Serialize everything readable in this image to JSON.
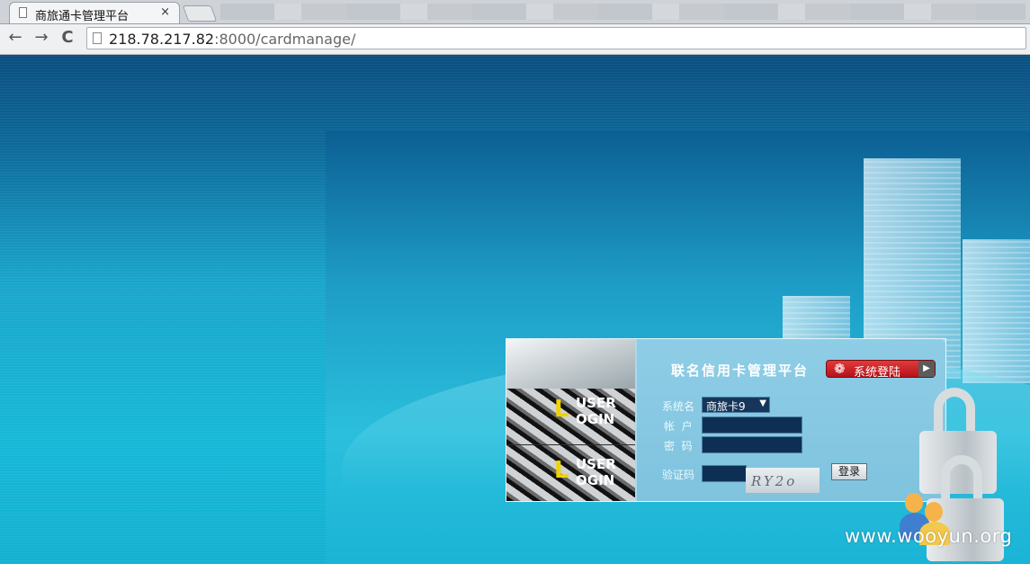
{
  "browser": {
    "tab_title": "商旅通卡管理平台",
    "tab_close": "×",
    "url_host": "218.78.217.82",
    "url_rest": ":8000/cardmanage/",
    "nav_back": "←",
    "nav_forward": "→",
    "nav_reload": "C"
  },
  "login": {
    "badge_letter": "L",
    "badge_line1": "USER",
    "badge_line2": "OGIN",
    "title": "联名信用卡管理平台",
    "system_login_button": "系统登陆",
    "system_label": "系统名",
    "system_value": "商旅卡9",
    "account_label": "帐  户",
    "password_label": "密  码",
    "captcha_label": "验证码",
    "captcha_text": "RY2o",
    "login_button": "登录"
  },
  "watermark": "www.wooyun.org"
}
